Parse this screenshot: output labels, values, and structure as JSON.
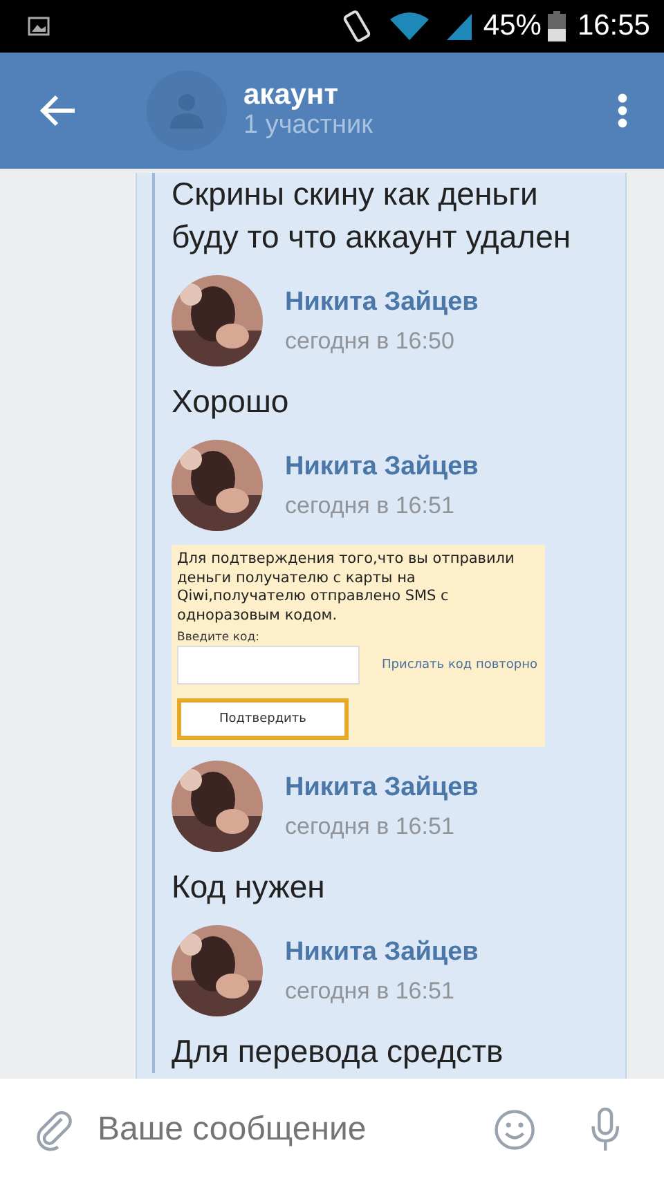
{
  "status_bar": {
    "battery": "45%",
    "time": "16:55"
  },
  "header": {
    "title": "акаунт",
    "subtitle": "1 участник"
  },
  "messages": [
    {
      "kind": "text",
      "text": "Скрины скину как деньги буду то что аккаунт удален"
    },
    {
      "kind": "author",
      "name": "Никита Зайцев",
      "time": "сегодня в 16:50"
    },
    {
      "kind": "text",
      "text": "Хорошо"
    },
    {
      "kind": "author",
      "name": "Никита Зайцев",
      "time": "сегодня в 16:51"
    },
    {
      "kind": "image",
      "message": "Для подтверждения того,что вы отправили деньги получателю с карты на Qiwi,получателю отправлено SMS с одноразовым кодом.",
      "label": "Введите код:",
      "link": "Прислать код повторно",
      "button": "Подтвердить"
    },
    {
      "kind": "author",
      "name": "Никита Зайцев",
      "time": "сегодня в 16:51"
    },
    {
      "kind": "text",
      "text": "Код нужен"
    },
    {
      "kind": "author",
      "name": "Никита Зайцев",
      "time": "сегодня в 16:51"
    },
    {
      "kind": "text",
      "text": "Для перевода средств"
    }
  ],
  "composer": {
    "placeholder": "Ваше сообщение"
  }
}
